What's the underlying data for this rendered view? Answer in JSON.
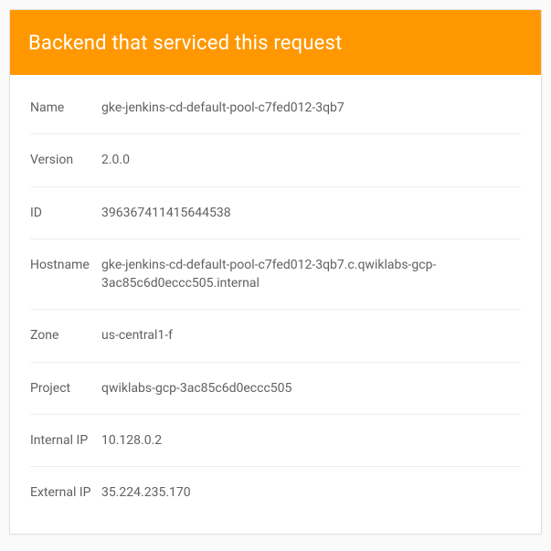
{
  "header": {
    "title": "Backend that serviced this request"
  },
  "fields": [
    {
      "label": "Name",
      "value": "gke-jenkins-cd-default-pool-c7fed012-3qb7"
    },
    {
      "label": "Version",
      "value": "2.0.0"
    },
    {
      "label": "ID",
      "value": "396367411415644538"
    },
    {
      "label": "Hostname",
      "value": "gke-jenkins-cd-default-pool-c7fed012-3qb7.c.qwiklabs-gcp-3ac85c6d0eccc505.internal"
    },
    {
      "label": "Zone",
      "value": "us-central1-f"
    },
    {
      "label": "Project",
      "value": "qwiklabs-gcp-3ac85c6d0eccc505"
    },
    {
      "label": "Internal IP",
      "value": "10.128.0.2"
    },
    {
      "label": "External IP",
      "value": "35.224.235.170"
    }
  ]
}
